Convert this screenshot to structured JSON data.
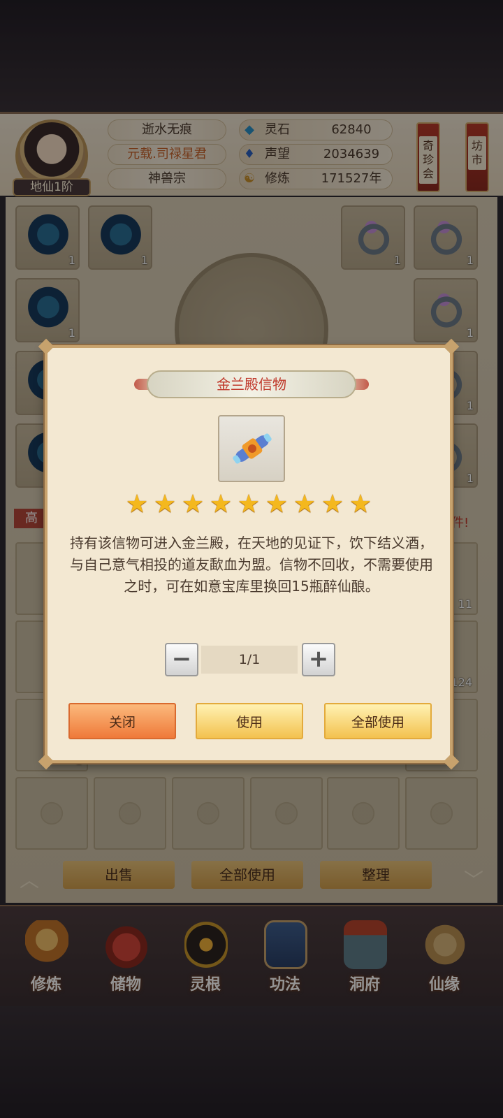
{
  "header": {
    "rank": "地仙1阶",
    "name": "逝水无痕",
    "title": "元载.司禄星君",
    "sect": "神兽宗",
    "stats": [
      {
        "icon": "spirit-stone-icon",
        "label": "灵石",
        "value": "62840"
      },
      {
        "icon": "prestige-icon",
        "label": "声望",
        "value": "2034639"
      },
      {
        "icon": "cultivation-icon",
        "label": "修炼",
        "value": "171527年"
      }
    ],
    "side_buttons": [
      {
        "label": "奇珍会"
      },
      {
        "label": "坊市"
      }
    ]
  },
  "bag": {
    "counts": [
      "1",
      "1",
      "1",
      "1",
      "1",
      "1",
      "1",
      "1",
      "1",
      "1",
      "11",
      "124",
      "1"
    ],
    "left_partial_label": "高",
    "right_partial_label": "多件!",
    "bottom_buttons": [
      "出售",
      "全部使用",
      "整理"
    ]
  },
  "dialog": {
    "title": "金兰殿信物",
    "stars": 9,
    "star_glyph": "★",
    "description": "持有该信物可进入金兰殿，在天地的见证下，饮下结义酒，与自己意气相投的道友歃血为盟。信物不回收，不需要使用之时，可在如意宝库里换回15瓶醉仙酿。",
    "quantity": "1/1",
    "minus": "−",
    "plus": "+",
    "buttons": {
      "close": "关闭",
      "use": "使用",
      "use_all": "全部使用"
    }
  },
  "nav": [
    {
      "label": "修炼",
      "icon": "cultivate-icon"
    },
    {
      "label": "储物",
      "icon": "storage-bag-icon"
    },
    {
      "label": "灵根",
      "icon": "spirit-root-icon"
    },
    {
      "label": "功法",
      "icon": "technique-book-icon"
    },
    {
      "label": "洞府",
      "icon": "cave-mansion-icon"
    },
    {
      "label": "仙缘",
      "icon": "immortal-fate-icon"
    }
  ],
  "colors": {
    "title_red": "#c0392b",
    "star_gold": "#f4b81e",
    "panel_cream": "#f3e8d2"
  }
}
